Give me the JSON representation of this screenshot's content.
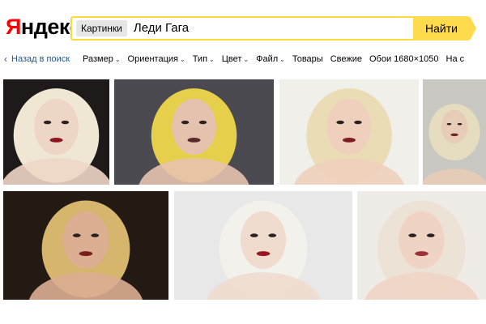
{
  "header": {
    "logo_part1": "Я",
    "logo_part2": "ндекс",
    "search": {
      "section_chip": "Картинки",
      "query": "Леди Гага",
      "clear_icon": "close-icon",
      "submit_label": "Найти"
    }
  },
  "filters": {
    "back_label": "Назад в поиск",
    "items": [
      {
        "label": "Размер",
        "dropdown": true
      },
      {
        "label": "Ориентация",
        "dropdown": true
      },
      {
        "label": "Тип",
        "dropdown": true
      },
      {
        "label": "Цвет",
        "dropdown": true
      },
      {
        "label": "Файл",
        "dropdown": true
      },
      {
        "label": "Товары",
        "dropdown": false
      },
      {
        "label": "Свежие",
        "dropdown": false
      },
      {
        "label": "Обои 1680×1050",
        "dropdown": false
      },
      {
        "label": "На с",
        "dropdown": false
      }
    ]
  },
  "results": {
    "images": [
      {
        "name": "result-image-1",
        "bg": "#1e1a1a",
        "hair": "#efe6d4",
        "skin": "#eed6c6",
        "lips": "#8a1620"
      },
      {
        "name": "result-image-2",
        "bg": "#4a4a50",
        "hair": "#e6cf4a",
        "skin": "#e5c2ae",
        "lips": "#5a2a2a"
      },
      {
        "name": "result-image-3",
        "bg": "#f1efe9",
        "hair": "#eadcb5",
        "skin": "#eed0bd",
        "lips": "#7e1c26"
      },
      {
        "name": "result-image-4",
        "bg": "#c9c7c2",
        "hair": "#e6dcbf",
        "skin": "#e7ccb8",
        "lips": "#6a2a2a"
      },
      {
        "name": "result-image-5",
        "bg": "#241a14",
        "hair": "#d6b56c",
        "skin": "#dcae92",
        "lips": "#7a1f1f"
      },
      {
        "name": "result-image-6",
        "bg": "#e8e8e8",
        "hair": "#f3f1ec",
        "skin": "#f0dccf",
        "lips": "#9a1722"
      },
      {
        "name": "result-image-7",
        "bg": "#efebe7",
        "hair": "#ece3d6",
        "skin": "#efd4c4",
        "lips": "#a0303a"
      }
    ]
  }
}
